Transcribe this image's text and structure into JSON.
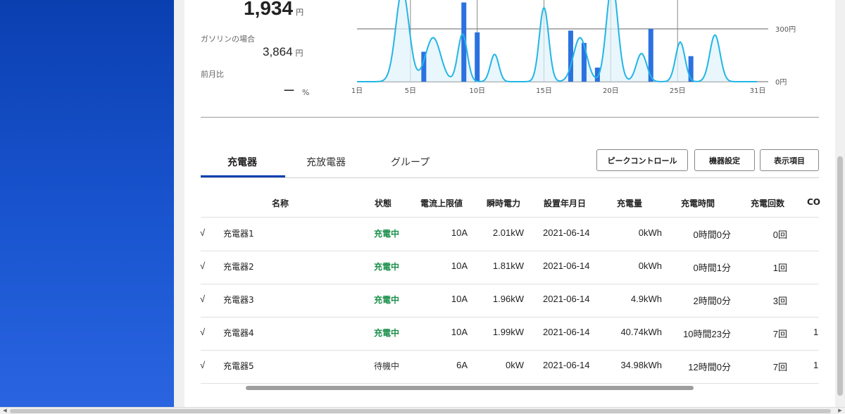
{
  "summary": {
    "total_amount": "1,934",
    "yen": "円",
    "gasoline_label": "ガソリンの場合",
    "gasoline_amount": "3,864",
    "prev_month_label": "前月比",
    "prev_month_value": "ー",
    "percent": "%"
  },
  "chart_data": {
    "type": "bar+line",
    "x_tick_labels": [
      "1日",
      "5日",
      "10日",
      "15日",
      "20日",
      "25日",
      "31日"
    ],
    "x_ticks": [
      1,
      5,
      10,
      15,
      20,
      25,
      31
    ],
    "y_tick_labels": [
      "0円",
      "300円"
    ],
    "y_ticks": [
      0,
      300
    ],
    "ylim": [
      0,
      450
    ],
    "grid": true,
    "colors": {
      "bar": "#2b72e0",
      "line": "#22b5e6",
      "area": "#dff2fb",
      "grid": "#666666"
    },
    "bars": [
      {
        "day": 6,
        "value": 170
      },
      {
        "day": 9,
        "value": 450
      },
      {
        "day": 10,
        "value": 280
      },
      {
        "day": 17,
        "value": 290
      },
      {
        "day": 18,
        "value": 220
      },
      {
        "day": 19,
        "value": 80
      },
      {
        "day": 23,
        "value": 300
      },
      {
        "day": 26,
        "value": 145
      }
    ],
    "line_peaks": [
      {
        "day": 4.4,
        "value": 520,
        "width": 0.7
      },
      {
        "day": 6.7,
        "value": 250,
        "width": 0.8
      },
      {
        "day": 8.9,
        "value": 270,
        "width": 0.5
      },
      {
        "day": 11.3,
        "value": 155,
        "width": 0.45
      },
      {
        "day": 15.0,
        "value": 420,
        "width": 0.5
      },
      {
        "day": 17.7,
        "value": 250,
        "width": 0.7
      },
      {
        "day": 20.1,
        "value": 560,
        "width": 0.6
      },
      {
        "day": 22.3,
        "value": 160,
        "width": 0.55
      },
      {
        "day": 25.2,
        "value": 225,
        "width": 0.5
      },
      {
        "day": 27.8,
        "value": 265,
        "width": 0.55
      }
    ]
  },
  "tabs": [
    {
      "label": "充電器",
      "active": true
    },
    {
      "label": "充放電器",
      "active": false
    },
    {
      "label": "グループ",
      "active": false
    }
  ],
  "buttons": {
    "peak_control": "ピークコントロール",
    "device_settings": "機器設定",
    "display_items": "表示項目"
  },
  "table": {
    "headers": {
      "name": "名称",
      "status": "状態",
      "current_limit": "電流上限値",
      "instant_power": "瞬時電力",
      "install_date": "設置年月日",
      "charge_amount": "充電量",
      "charge_time": "充電時間",
      "charge_count": "充電回数",
      "co": "CO"
    },
    "rows": [
      {
        "check": "√",
        "name": "充電器1",
        "status": "充電中",
        "charging": true,
        "current_limit": "10A",
        "instant_power": "2.01kW",
        "install_date": "2021-06-14",
        "charge_amount": "0kWh",
        "charge_time": "0時間0分",
        "charge_count": "0回",
        "co": ""
      },
      {
        "check": "√",
        "name": "充電器2",
        "status": "充電中",
        "charging": true,
        "current_limit": "10A",
        "instant_power": "1.81kW",
        "install_date": "2021-06-14",
        "charge_amount": "0kWh",
        "charge_time": "0時間1分",
        "charge_count": "1回",
        "co": ""
      },
      {
        "check": "√",
        "name": "充電器3",
        "status": "充電中",
        "charging": true,
        "current_limit": "10A",
        "instant_power": "1.96kW",
        "install_date": "2021-06-14",
        "charge_amount": "4.9kWh",
        "charge_time": "2時間0分",
        "charge_count": "3回",
        "co": ""
      },
      {
        "check": "√",
        "name": "充電器4",
        "status": "充電中",
        "charging": true,
        "current_limit": "10A",
        "instant_power": "1.99kW",
        "install_date": "2021-06-14",
        "charge_amount": "40.74kWh",
        "charge_time": "10時間23分",
        "charge_count": "7回",
        "co": "1"
      },
      {
        "check": "√",
        "name": "充電器5",
        "status": "待機中",
        "charging": false,
        "current_limit": "6A",
        "instant_power": "0kW",
        "install_date": "2021-06-14",
        "charge_amount": "34.98kWh",
        "charge_time": "12時間0分",
        "charge_count": "7回",
        "co": "1"
      }
    ]
  }
}
